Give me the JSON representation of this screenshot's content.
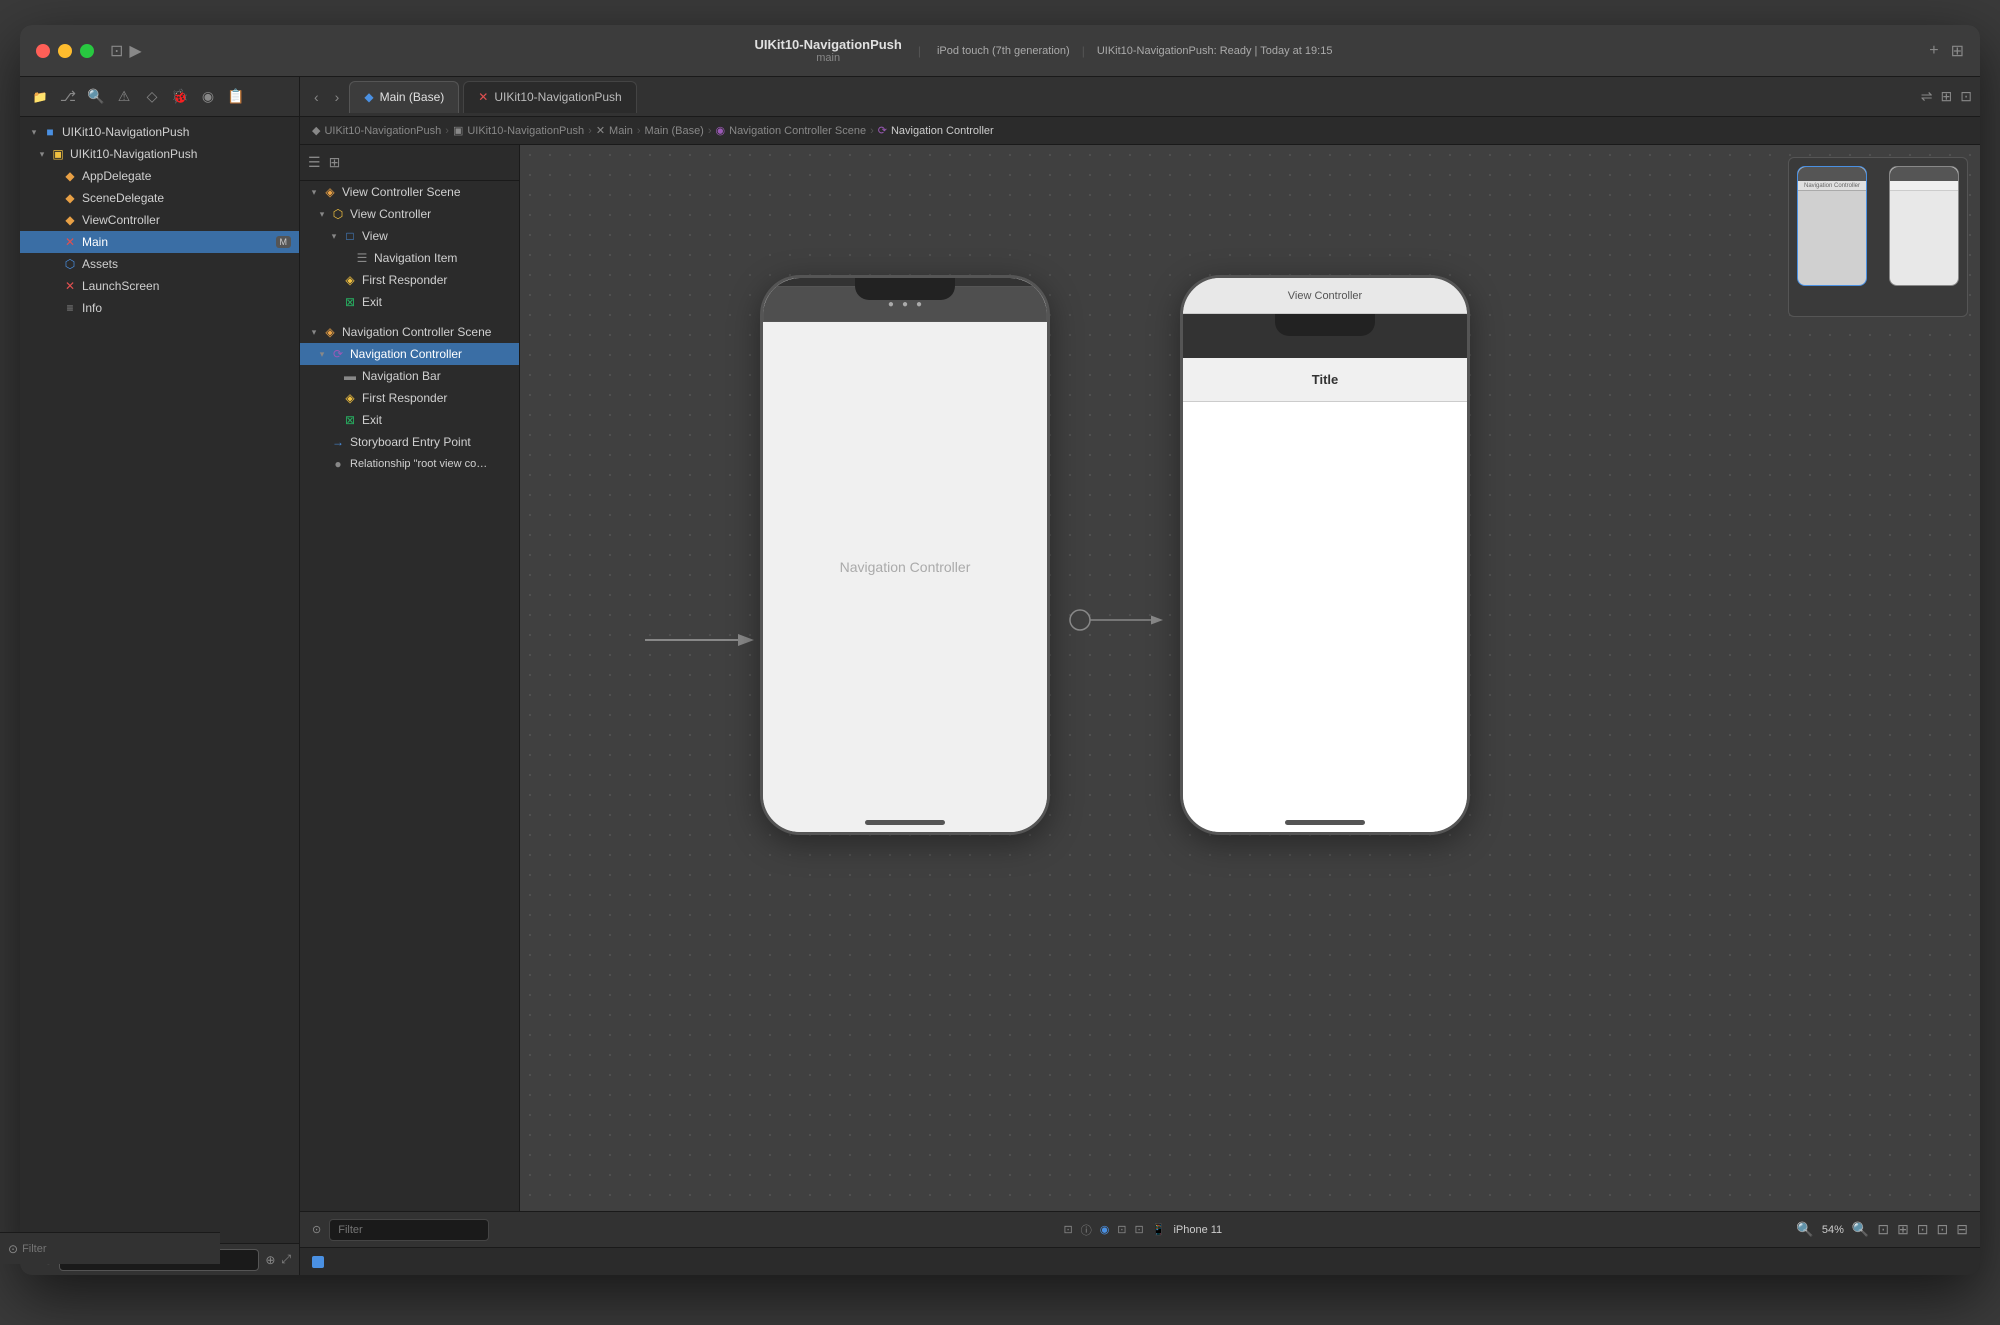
{
  "window": {
    "title": "UIKit10-NavigationPush",
    "subtitle": "main",
    "status": "UIKit10-NavigationPush: Ready | Today at 19:15",
    "device": "iPod touch (7th generation)"
  },
  "titlebar": {
    "project_name": "UIKit10-NavigationPush",
    "main_label": "main",
    "status_label": "UIKit10-NavigationPush: Ready | Today at 19:15",
    "device_label": "iPod touch (7th generation)"
  },
  "tabs": [
    {
      "label": "Main (Base)",
      "icon": "◆",
      "active": true
    },
    {
      "label": "UIKit10-NavigationPush",
      "icon": "X",
      "active": false
    }
  ],
  "breadcrumb": {
    "items": [
      "UIKit10-NavigationPush",
      "UIKit10-NavigationPush",
      "Main",
      "Main (Base)",
      "Navigation Controller Scene",
      "Navigation Controller"
    ]
  },
  "sidebar": {
    "project_name": "UIKit10-NavigationPush",
    "items": [
      {
        "label": "UIKit10-NavigationPush",
        "indent": 1,
        "type": "folder",
        "expanded": true
      },
      {
        "label": "UIKit10-NavigationPush",
        "indent": 2,
        "type": "folder",
        "expanded": true
      },
      {
        "label": "AppDelegate",
        "indent": 3,
        "type": "swift",
        "icon": "orange"
      },
      {
        "label": "SceneDelegate",
        "indent": 3,
        "type": "swift",
        "icon": "orange"
      },
      {
        "label": "ViewController",
        "indent": 3,
        "type": "swift",
        "icon": "orange"
      },
      {
        "label": "Main",
        "indent": 3,
        "type": "storyboard",
        "badge": "M"
      },
      {
        "label": "Assets",
        "indent": 3,
        "type": "assets"
      },
      {
        "label": "LaunchScreen",
        "indent": 3,
        "type": "storyboard"
      },
      {
        "label": "Info",
        "indent": 3,
        "type": "plist"
      }
    ],
    "filter_placeholder": "Filter"
  },
  "scene_outline": {
    "items": [
      {
        "label": "View Controller Scene",
        "indent": 0,
        "type": "scene",
        "expanded": true
      },
      {
        "label": "View Controller",
        "indent": 1,
        "type": "vc",
        "expanded": true
      },
      {
        "label": "View",
        "indent": 2,
        "type": "view"
      },
      {
        "label": "Navigation Item",
        "indent": 3,
        "type": "nav_item"
      },
      {
        "label": "First Responder",
        "indent": 2,
        "type": "responder"
      },
      {
        "label": "Exit",
        "indent": 2,
        "type": "exit"
      },
      {
        "label": "Navigation Controller Scene",
        "indent": 0,
        "type": "scene",
        "expanded": true
      },
      {
        "label": "Navigation Controller",
        "indent": 1,
        "type": "nav_ctrl",
        "expanded": true,
        "selected": true
      },
      {
        "label": "Navigation Bar",
        "indent": 2,
        "type": "nav_bar"
      },
      {
        "label": "First Responder",
        "indent": 2,
        "type": "responder"
      },
      {
        "label": "Exit",
        "indent": 2,
        "type": "exit"
      },
      {
        "label": "Storyboard Entry Point",
        "indent": 1,
        "type": "entry"
      },
      {
        "label": "Relationship \"root view control...\"",
        "indent": 1,
        "type": "relationship"
      }
    ]
  },
  "canvas": {
    "nav_controller_label": "Navigation Controller",
    "vc_label": "View Controller",
    "nav_bar_title": "Title",
    "zoom_percent": "54%"
  },
  "bottom_bar": {
    "device_label": "iPhone 11",
    "zoom_label": "54%",
    "filter_icon": "⊙"
  },
  "minimap": {
    "visible": true
  }
}
